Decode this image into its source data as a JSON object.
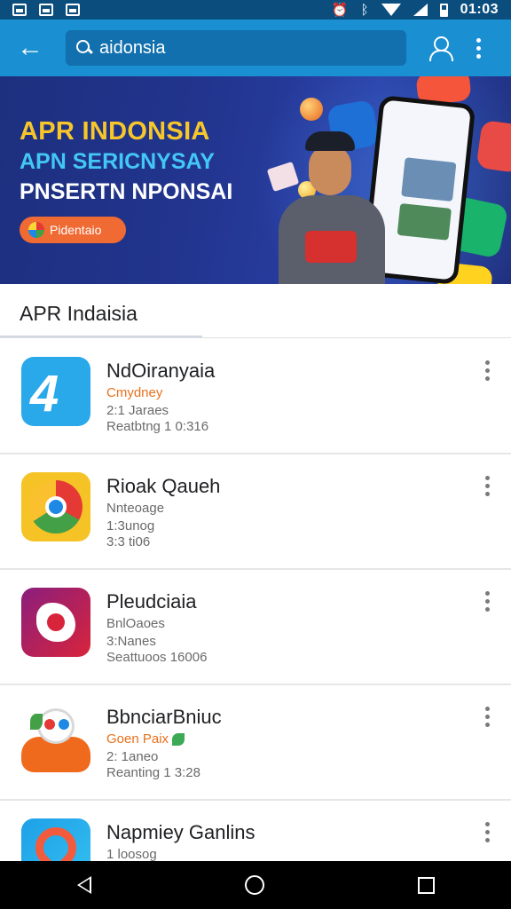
{
  "status_bar": {
    "time": "01:03"
  },
  "app_bar": {
    "search_text": "aidonsia"
  },
  "banner": {
    "line1": "APR INDONSIA",
    "line2": "APN SERICNYSAY",
    "line3": "PNSERTN NPONSAI",
    "button_label": "Pidentaio"
  },
  "section": {
    "title": "APR Indaisia"
  },
  "apps": [
    {
      "name": "NdOiranyaia",
      "line1": "Cmydney",
      "line2": "2:1 Jaraes",
      "line3": "Reatbtng 1 0:316",
      "accent_color": "#e8711c"
    },
    {
      "name": "Rioak Qaueh",
      "line1": "Nnteoage",
      "line2": "1:3unog",
      "line3": "3:3 ti06"
    },
    {
      "name": "Pleudciaia",
      "line1": "BnlOaoes",
      "line2": "3:Nanes",
      "line3": "Seattuoos 16006"
    },
    {
      "name": "BbnciarBniuc",
      "line1": "Goen Paix",
      "line2": "2: 1aneo",
      "line3": "Reanting 1 3:28",
      "accent_color": "#e8711c"
    },
    {
      "name": "Napmiey Ganlins",
      "line1": "1 loosog"
    }
  ],
  "icons": {
    "back": "arrow-left-icon",
    "search": "search-icon",
    "profile": "person-icon",
    "more": "more-vert-icon",
    "nav_back": "triangle-back-icon",
    "nav_home": "circle-home-icon",
    "nav_recent": "square-recents-icon"
  },
  "colors": {
    "app_bar": "#1a8fd1",
    "status_bar": "#0b4e7e",
    "banner_yellow": "#f6c62b",
    "banner_cyan": "#43c7f4",
    "banner_button": "#f06a33"
  }
}
